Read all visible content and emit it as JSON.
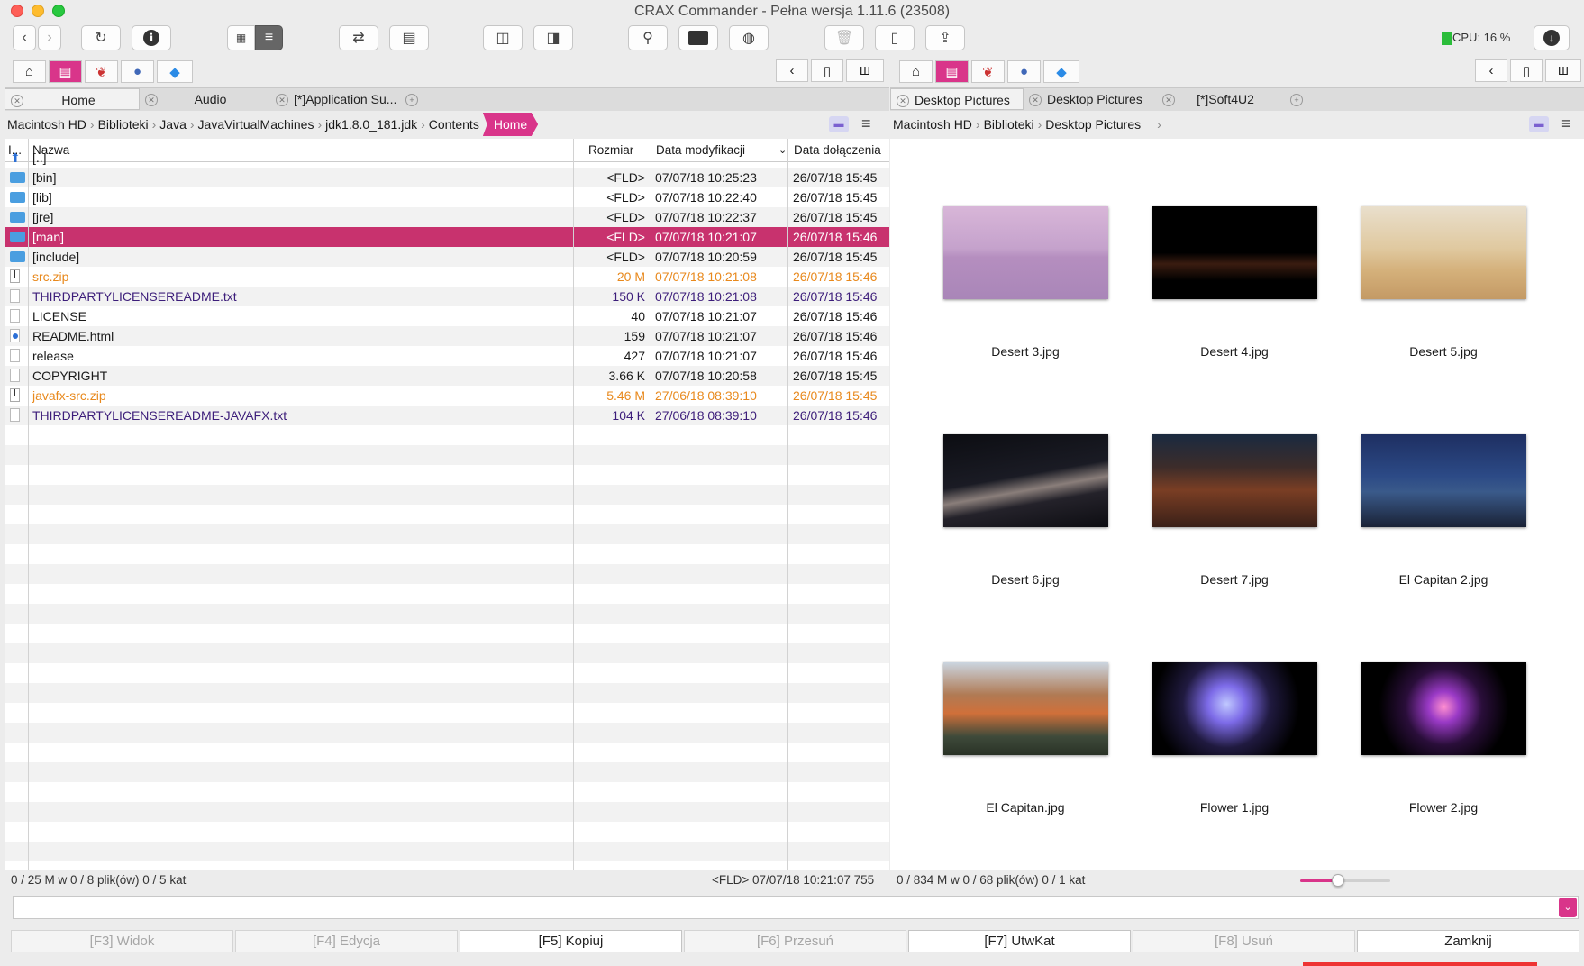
{
  "window": {
    "title": "CRAX Commander - Pełna wersja 1.11.6 (23508)"
  },
  "cpu": {
    "label": "CPU: 16 %"
  },
  "left": {
    "tabs": [
      {
        "label": "Home"
      },
      {
        "label": "Audio"
      },
      {
        "label": "[*]Application Su..."
      }
    ],
    "breadcrumb": [
      "Macintosh HD",
      "Biblioteki",
      "Java",
      "JavaVirtualMachines",
      "jdk1.8.0_181.jdk",
      "Contents",
      "Home"
    ],
    "columns": {
      "icon": "I...",
      "name": "Nazwa",
      "size": "Rozmiar",
      "modified": "Data modyfikacji",
      "added": "Data dołączenia"
    },
    "rows": [
      {
        "icon": "up",
        "name": "[..]",
        "size": "",
        "modified": "",
        "added": "",
        "kind": "normal"
      },
      {
        "icon": "folder",
        "name": "[bin]",
        "size": "<FLD>",
        "modified": "07/07/18 10:25:23",
        "added": "26/07/18 15:45",
        "kind": "normal"
      },
      {
        "icon": "folder",
        "name": "[lib]",
        "size": "<FLD>",
        "modified": "07/07/18 10:22:40",
        "added": "26/07/18 15:45",
        "kind": "normal"
      },
      {
        "icon": "folder",
        "name": "[jre]",
        "size": "<FLD>",
        "modified": "07/07/18 10:22:37",
        "added": "26/07/18 15:45",
        "kind": "normal"
      },
      {
        "icon": "folder",
        "name": "[man]",
        "size": "<FLD>",
        "modified": "07/07/18 10:21:07",
        "added": "26/07/18 15:46",
        "kind": "selected"
      },
      {
        "icon": "folder",
        "name": "[include]",
        "size": "<FLD>",
        "modified": "07/07/18 10:20:59",
        "added": "26/07/18 15:45",
        "kind": "normal"
      },
      {
        "icon": "zip",
        "name": "src.zip",
        "size": "20 M",
        "modified": "07/07/18 10:21:08",
        "added": "26/07/18 15:46",
        "kind": "orange"
      },
      {
        "icon": "doc",
        "name": "THIRDPARTYLICENSEREADME.txt",
        "size": "150 K",
        "modified": "07/07/18 10:21:08",
        "added": "26/07/18 15:46",
        "kind": "purple"
      },
      {
        "icon": "doc",
        "name": "LICENSE",
        "size": "40",
        "modified": "07/07/18 10:21:07",
        "added": "26/07/18 15:46",
        "kind": "normal"
      },
      {
        "icon": "html",
        "name": "README.html",
        "size": "159",
        "modified": "07/07/18 10:21:07",
        "added": "26/07/18 15:46",
        "kind": "normal"
      },
      {
        "icon": "doc",
        "name": "release",
        "size": "427",
        "modified": "07/07/18 10:21:07",
        "added": "26/07/18 15:46",
        "kind": "normal"
      },
      {
        "icon": "doc",
        "name": "COPYRIGHT",
        "size": "3.66 K",
        "modified": "07/07/18 10:20:58",
        "added": "26/07/18 15:45",
        "kind": "normal"
      },
      {
        "icon": "zip",
        "name": "javafx-src.zip",
        "size": "5.46 M",
        "modified": "27/06/18 08:39:10",
        "added": "26/07/18 15:45",
        "kind": "orange"
      },
      {
        "icon": "doc",
        "name": "THIRDPARTYLICENSEREADME-JAVAFX.txt",
        "size": "104 K",
        "modified": "27/06/18 08:39:10",
        "added": "26/07/18 15:46",
        "kind": "purple"
      }
    ],
    "status_left": "0 / 25 M w 0 / 8 plik(ów) 0 / 5 kat",
    "status_right": "<FLD> 07/07/18 10:21:07 755"
  },
  "right": {
    "tabs": [
      {
        "label": "Desktop Pictures"
      },
      {
        "label": "Desktop Pictures"
      },
      {
        "label": "[*]Soft4U2"
      }
    ],
    "breadcrumb": [
      "Macintosh HD",
      "Biblioteki",
      "Desktop Pictures"
    ],
    "thumbs": [
      {
        "name": "Desert 3.jpg",
        "art": "desert3"
      },
      {
        "name": "Desert 4.jpg",
        "art": "desert4"
      },
      {
        "name": "Desert 5.jpg",
        "art": "desert5"
      },
      {
        "name": "Desert 6.jpg",
        "art": "desert6"
      },
      {
        "name": "Desert 7.jpg",
        "art": "desert7"
      },
      {
        "name": "El Capitan 2.jpg",
        "art": "elcap2"
      },
      {
        "name": "El Capitan.jpg",
        "art": "elcap"
      },
      {
        "name": "Flower 1.jpg",
        "art": "flower1"
      },
      {
        "name": "Flower 2.jpg",
        "art": "flower2"
      }
    ],
    "status": "0 / 834 M w 0 / 68 plik(ów) 0 / 1 kat",
    "thumb_slider_level": 0.42
  },
  "fkeys": [
    {
      "label": "[F3] Widok",
      "enabled": false
    },
    {
      "label": "[F4] Edycja",
      "enabled": false
    },
    {
      "label": "[F5] Kopiuj",
      "enabled": true
    },
    {
      "label": "[F6] Przesuń",
      "enabled": false
    },
    {
      "label": "[F7] UtwKat",
      "enabled": true
    },
    {
      "label": "[F8] Usuń",
      "enabled": false
    },
    {
      "label": "Zamknij",
      "enabled": true
    }
  ],
  "colors": {
    "accent": "#d9358a",
    "selection": "#c8326e",
    "orange": "#e8891d",
    "purple": "#3c1d7a",
    "folder": "#4a9ee0"
  }
}
